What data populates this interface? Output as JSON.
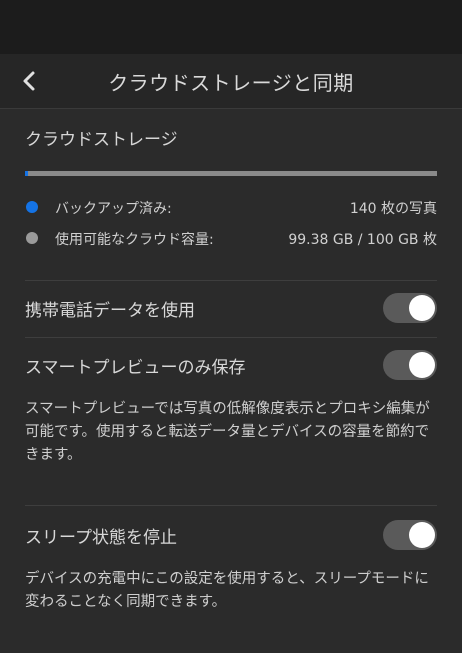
{
  "header": {
    "title": "クラウドストレージと同期",
    "back_icon": "chevron-left-icon"
  },
  "cloud_storage": {
    "section_title": "クラウドストレージ",
    "used_fraction": 0.0062,
    "fill_color": "#1473e6",
    "track_color": "#8a8a8a",
    "legend": [
      {
        "label": "バックアップ済み:",
        "value": "140 枚の写真",
        "color": "#1473e6"
      },
      {
        "label": "使用可能なクラウド容量:",
        "value": "99.38 GB / 100 GB 枚",
        "color": "#9a9a9a"
      }
    ]
  },
  "settings": {
    "use_mobile_data": {
      "label": "携帯電話データを使用",
      "enabled": true
    },
    "smart_preview_only": {
      "label": "スマートプレビューのみ保存",
      "enabled": true
    },
    "smart_preview_desc": "スマートプレビューでは写真の低解像度表示とプロキシ編集が可能です。使用すると転送データ量とデバイスの容量を節約できます。",
    "prevent_sleep": {
      "label": "スリープ状態を停止",
      "enabled": true
    },
    "prevent_sleep_desc": "デバイスの充電中にこの設定を使用すると、スリープモードに変わることなく同期できます。"
  }
}
